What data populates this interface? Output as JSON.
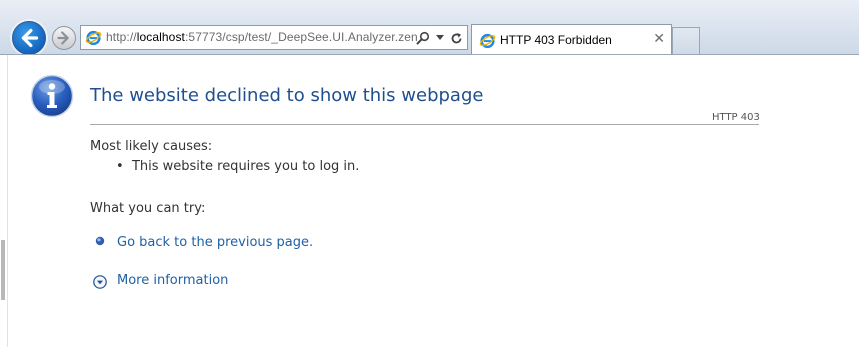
{
  "browser": {
    "address_bar": {
      "url_prefix": "http://",
      "url_host": "localhost",
      "url_rest": ":57773/csp/test/_DeepSee.UI.Analyzer.zen"
    },
    "tab": {
      "title": "HTTP 403 Forbidden",
      "close_glyph": "✕"
    },
    "icons": [
      "back-arrow-icon",
      "forward-arrow-icon",
      "ie-logo-icon",
      "search-icon",
      "dropdown-icon",
      "refresh-icon",
      "close-icon"
    ]
  },
  "error_page": {
    "heading": "The website declined to show this webpage",
    "code": "HTTP 403",
    "causes_label": "Most likely causes:",
    "causes": [
      "This website requires you to log in."
    ],
    "try_label": "What you can try:",
    "links": {
      "go_back": "Go back to the previous page.",
      "more_info": "More information"
    },
    "colors": {
      "heading": "#1f4f8f",
      "link": "#1f60a6",
      "back_button": "#1568c0"
    }
  }
}
